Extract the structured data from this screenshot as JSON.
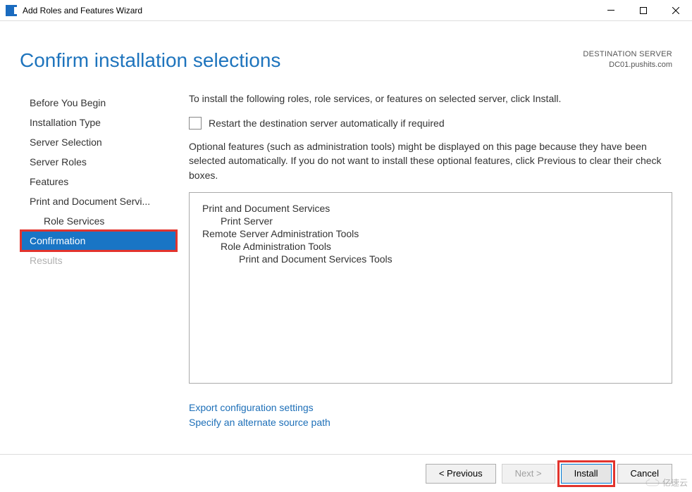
{
  "titlebar": {
    "title": "Add Roles and Features Wizard"
  },
  "header": {
    "page_title": "Confirm installation selections",
    "destination_label": "DESTINATION SERVER",
    "destination_value": "DC01.pushits.com"
  },
  "nav": {
    "items": [
      {
        "label": "Before You Begin",
        "sub": false,
        "selected": false,
        "disabled": false
      },
      {
        "label": "Installation Type",
        "sub": false,
        "selected": false,
        "disabled": false
      },
      {
        "label": "Server Selection",
        "sub": false,
        "selected": false,
        "disabled": false
      },
      {
        "label": "Server Roles",
        "sub": false,
        "selected": false,
        "disabled": false
      },
      {
        "label": "Features",
        "sub": false,
        "selected": false,
        "disabled": false
      },
      {
        "label": "Print and Document Servi...",
        "sub": false,
        "selected": false,
        "disabled": false
      },
      {
        "label": "Role Services",
        "sub": true,
        "selected": false,
        "disabled": false
      },
      {
        "label": "Confirmation",
        "sub": false,
        "selected": true,
        "disabled": false
      },
      {
        "label": "Results",
        "sub": false,
        "selected": false,
        "disabled": true
      }
    ]
  },
  "main": {
    "intro": "To install the following roles, role services, or features on selected server, click Install.",
    "checkbox_label": "Restart the destination server automatically if required",
    "optional_text": "Optional features (such as administration tools) might be displayed on this page because they have been selected automatically. If you do not want to install these optional features, click Previous to clear their check boxes.",
    "listbox": [
      {
        "label": "Print and Document Services",
        "level": 0
      },
      {
        "label": "Print Server",
        "level": 1
      },
      {
        "label": "Remote Server Administration Tools",
        "level": 0
      },
      {
        "label": "Role Administration Tools",
        "level": 1
      },
      {
        "label": "Print and Document Services Tools",
        "level": 2
      }
    ],
    "export_link": "Export configuration settings",
    "alt_path_link": "Specify an alternate source path"
  },
  "footer": {
    "previous": "< Previous",
    "next": "Next >",
    "install": "Install",
    "cancel": "Cancel"
  },
  "watermark": "亿速云"
}
